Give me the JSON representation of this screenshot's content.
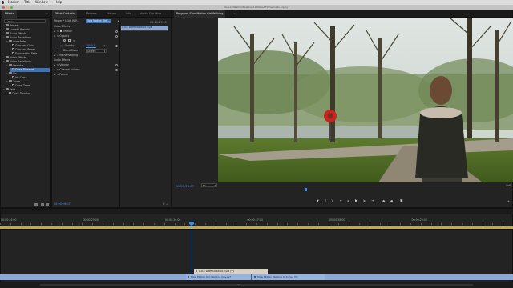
{
  "menubar": {
    "items": [
      "Marker",
      "Title",
      "Window",
      "Help"
    ]
  },
  "window": {
    "title": "/Users/MikeVitz/Desktop/LLANGGA/Homemade.prproj *"
  },
  "effects_panel": {
    "tab": "Effects",
    "search_placeholder": "Enter",
    "tree": [
      {
        "label": "Presets",
        "level": 0,
        "kind": "folder"
      },
      {
        "label": "Lumetri Presets",
        "level": 0,
        "kind": "folder"
      },
      {
        "label": "Audio Effects",
        "level": 0,
        "kind": "folder"
      },
      {
        "label": "Audio Transitions",
        "level": 0,
        "kind": "folder",
        "open": true
      },
      {
        "label": "Crossfade",
        "level": 1,
        "kind": "folder",
        "open": true
      },
      {
        "label": "Constant Gain",
        "level": 2,
        "kind": "item"
      },
      {
        "label": "Constant Power",
        "level": 2,
        "kind": "item"
      },
      {
        "label": "Exponential Fade",
        "level": 2,
        "kind": "item"
      },
      {
        "label": "Video Effects",
        "level": 0,
        "kind": "folder"
      },
      {
        "label": "Video Transitions",
        "level": 0,
        "kind": "folder",
        "open": true
      },
      {
        "label": "Dissolve",
        "level": 1,
        "kind": "folder",
        "open": true
      },
      {
        "label": "Cross Dissolve",
        "level": 2,
        "kind": "item",
        "selected": true
      },
      {
        "label": "Iris",
        "level": 1,
        "kind": "folder",
        "open": true
      },
      {
        "label": "Iris Cross",
        "level": 2,
        "kind": "item"
      },
      {
        "label": "Zoom",
        "level": 1,
        "kind": "folder",
        "open": true
      },
      {
        "label": "Cross Zoom",
        "level": 2,
        "kind": "item"
      },
      {
        "label": "Fairs",
        "level": 0,
        "kind": "folder",
        "open": true
      },
      {
        "label": "Cross Dissolve",
        "level": 1,
        "kind": "item"
      }
    ]
  },
  "effect_controls": {
    "tabs": [
      "Effect Controls",
      "Markers",
      "History",
      "Info",
      "Audio Clip Mixe"
    ],
    "master_label": "Master * LUAK WIP...",
    "clip_label": "Slow Motion Girl ...",
    "timecode_top": "00:00:27:00",
    "sections": {
      "video_effects": "Video Effects",
      "motion": "Motion",
      "opacity": "Opacity",
      "opacity_prop": "Opacity",
      "opacity_value": "100.0 %",
      "blend_mode": "Blend Mode",
      "blend_value": "Screen",
      "time_remapping": "Time Remapping",
      "audio_effects": "Audio Effects",
      "volume": "Volume",
      "channel_volume": "Channel Volume",
      "panner": "Panner"
    },
    "clip_bar_label": "LUAK WIPE MARK 01.mp4",
    "timecode_bottom": "00:00:26:07"
  },
  "program_monitor": {
    "title": "Program: Slow Motion Girl Walking",
    "timecode": "00:00:26:07",
    "fit": "Fit",
    "quality": "Full"
  },
  "timeline": {
    "ruler_labels": [
      "00:00:24:00",
      "00:00:25:00",
      "00:00:26:00",
      "00:00:27:00",
      "00:00:28:00",
      "00:00:29:00"
    ],
    "clips": {
      "upper": "LUAK WIPE MARK 01.mp4 [V]",
      "lower_a": "Slow Motion Girl Walking.mov [V]",
      "lower_b": "Slow Motion Walking 013.mov [V]"
    },
    "bottom_label": "11"
  },
  "colors": {
    "accent": "#4e8fe0",
    "selection": "#3e73b8",
    "clip_video": "#8aa8d8",
    "playhead": "#3c8fe8"
  }
}
